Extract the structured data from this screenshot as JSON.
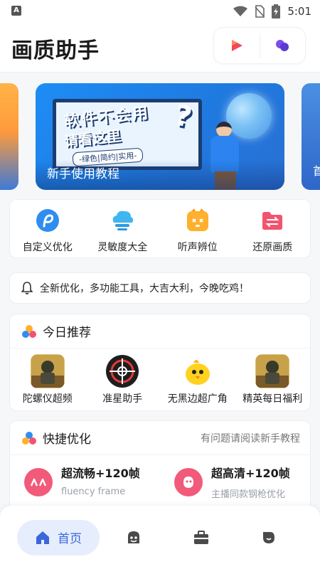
{
  "status_bar": {
    "time": "5:01",
    "icons": [
      "wifi-icon",
      "no-sim-icon",
      "battery-charging-icon"
    ]
  },
  "header": {
    "title": "画质助手",
    "actions": [
      "video-app-icon",
      "bubbles-app-icon"
    ]
  },
  "banner": {
    "caption": "新手使用教程",
    "headline": "软件不会用",
    "subline": "请看这里",
    "tagline": "-绿色|简约|实用-",
    "side_right_caption": "首"
  },
  "quick_tools": [
    {
      "label": "自定义优化",
      "icon": "custom-optimize-icon"
    },
    {
      "label": "灵敏度大全",
      "icon": "sensitivity-icon"
    },
    {
      "label": "听声辨位",
      "icon": "sound-locate-icon"
    },
    {
      "label": "还原画质",
      "icon": "restore-quality-icon"
    }
  ],
  "notice": {
    "text": "全新优化，多功能工具，大吉大利，今晚吃鸡！",
    "icon": "bell-icon"
  },
  "recommend": {
    "title": "今日推荐",
    "items": [
      {
        "name": "陀螺仪超频",
        "thumb": "game-thumb-icon"
      },
      {
        "name": "准星助手",
        "thumb": "crosshair-icon"
      },
      {
        "name": "无黑边超广角",
        "thumb": "chick-icon"
      },
      {
        "name": "精英每日福利",
        "thumb": "game-thumb-icon"
      }
    ]
  },
  "shortcut": {
    "title": "快捷优化",
    "link": "有问题请阅读新手教程",
    "items": [
      {
        "title": "超流畅+120帧",
        "subtitle": "fluency frame",
        "color": "#f25a7a"
      },
      {
        "title": "超高清+120帧",
        "subtitle": "主播同款钢枪优化",
        "color": "#f25a7a"
      }
    ]
  },
  "bottom_nav": {
    "home_label": "首页",
    "icons": [
      "home-icon",
      "bot-icon",
      "toolbox-icon",
      "profile-icon"
    ]
  },
  "colors": {
    "accent": "#3b67d9",
    "accent_bg": "#e6eefe",
    "pink": "#f25a7a"
  }
}
